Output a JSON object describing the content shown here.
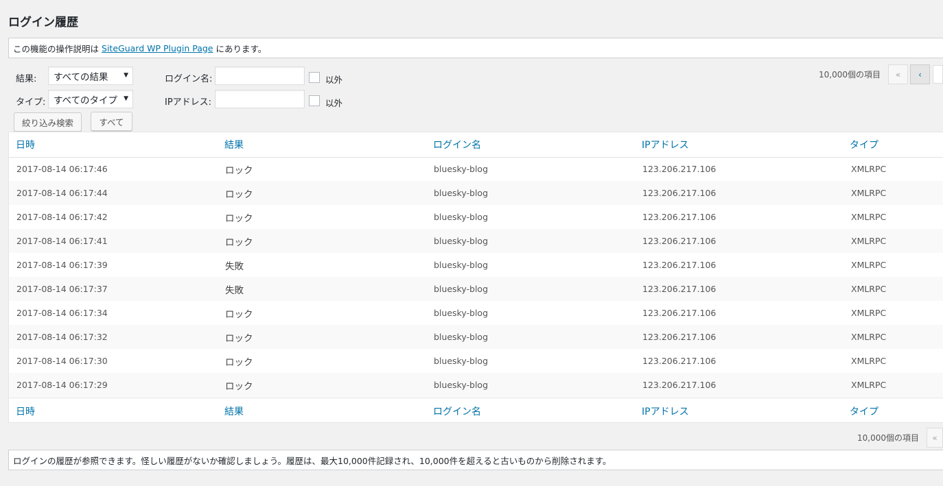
{
  "page_title": "ログイン履歴",
  "notice_top": {
    "prefix": "この機能の操作説明は",
    "link": "SiteGuard WP Plugin Page",
    "suffix": "にあります。"
  },
  "filters": {
    "result_label": "結果:",
    "result_value": "すべての結果",
    "type_label": "タイプ:",
    "type_value": "すべてのタイプ",
    "login_label": "ログイン名:",
    "ip_label": "IPアドレス:",
    "exclude_label": "以外",
    "caret": "▼",
    "search_button": "絞り込み検索",
    "all_button": "すべて"
  },
  "pagination": {
    "count_top": "10,000個の項目",
    "count_bottom": "10,000個の項目",
    "first": "«",
    "prev": "‹"
  },
  "table": {
    "headers": [
      "日時",
      "結果",
      "ログイン名",
      "IPアドレス",
      "タイプ"
    ],
    "rows": [
      [
        "2017-08-14 06:17:46",
        "ロック",
        "bluesky-blog",
        "123.206.217.106",
        "XMLRPC"
      ],
      [
        "2017-08-14 06:17:44",
        "ロック",
        "bluesky-blog",
        "123.206.217.106",
        "XMLRPC"
      ],
      [
        "2017-08-14 06:17:42",
        "ロック",
        "bluesky-blog",
        "123.206.217.106",
        "XMLRPC"
      ],
      [
        "2017-08-14 06:17:41",
        "ロック",
        "bluesky-blog",
        "123.206.217.106",
        "XMLRPC"
      ],
      [
        "2017-08-14 06:17:39",
        "失敗",
        "bluesky-blog",
        "123.206.217.106",
        "XMLRPC"
      ],
      [
        "2017-08-14 06:17:37",
        "失敗",
        "bluesky-blog",
        "123.206.217.106",
        "XMLRPC"
      ],
      [
        "2017-08-14 06:17:34",
        "ロック",
        "bluesky-blog",
        "123.206.217.106",
        "XMLRPC"
      ],
      [
        "2017-08-14 06:17:32",
        "ロック",
        "bluesky-blog",
        "123.206.217.106",
        "XMLRPC"
      ],
      [
        "2017-08-14 06:17:30",
        "ロック",
        "bluesky-blog",
        "123.206.217.106",
        "XMLRPC"
      ],
      [
        "2017-08-14 06:17:29",
        "ロック",
        "bluesky-blog",
        "123.206.217.106",
        "XMLRPC"
      ]
    ]
  },
  "notice_bottom": "ログインの履歴が参照できます。怪しい履歴がないか確認しましょう。履歴は、最大10,000件記録され、10,000件を超えると古いものから削除されます。",
  "colors": {
    "link": "#0073aa",
    "background": "#f1f1f1",
    "text": "#23282d"
  }
}
